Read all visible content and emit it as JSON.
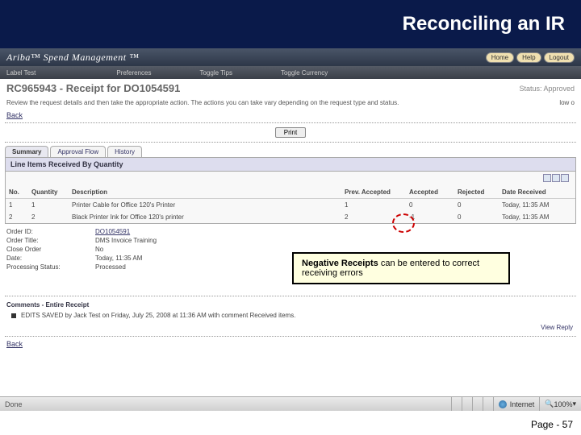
{
  "slide": {
    "title": "Reconciling an IR",
    "footer": "Page - 57"
  },
  "app": {
    "brand": "Ariba™ Spend Management ™",
    "buttons": {
      "home": "Home",
      "help": "Help",
      "logout": "Logout"
    },
    "nav": {
      "left": "Label  Test",
      "prefs": "Preferences",
      "tips": "Toggle Tips",
      "currency": "Toggle Currency"
    }
  },
  "page": {
    "title": "RC965943 - Receipt for DO1054591",
    "status": "Status: Approved",
    "instruction": "Review the request details and then take the appropriate action. The actions you can take vary depending on the request type and status.",
    "low": "low  o",
    "back": "Back",
    "print": "Print"
  },
  "tabs": {
    "summary": "Summary",
    "approval": "Approval Flow",
    "history": "History"
  },
  "panel": {
    "heading": "Line Items Received By Quantity"
  },
  "columns": {
    "no": "No.",
    "qty": "Quantity",
    "desc": "Description",
    "prev": "Prev. Accepted",
    "acc": "Accepted",
    "rej": "Rejected",
    "date": "Date Received"
  },
  "rows": [
    {
      "no": "1",
      "qty": "1",
      "desc": "Printer Cable for Office 120's Printer",
      "prev": "1",
      "acc": "0",
      "rej": "0",
      "date": "Today, 11:35 AM"
    },
    {
      "no": "2",
      "qty": "2",
      "desc": "Black Printer Ink for Office 120's printer",
      "prev": "2",
      "acc": "-1",
      "rej": "0",
      "date": "Today, 11:35 AM"
    }
  ],
  "meta": {
    "order_id_l": "Order ID:",
    "order_id_v": "DO1054591",
    "order_title_l": "Order Title:",
    "order_title_v": "DMS    Invoice Training",
    "close_l": "Close Order",
    "close_v": "No",
    "date_l": "Date:",
    "date_v": "Today, 11:35 AM",
    "proc_l": "Processing Status:",
    "proc_v": "Processed"
  },
  "callout": {
    "strong": "Negative Receipts",
    "rest": " can be entered to correct receiving errors"
  },
  "comments": {
    "heading": "Comments - Entire Receipt",
    "body": "EDITS SAVED by Jack Test on Friday, July 25, 2008 at 11:36 AM with comment Received items.",
    "view_reply": "View  Reply"
  },
  "statusbar": {
    "done": "Done",
    "zone": "Internet",
    "zoom": "100%"
  }
}
